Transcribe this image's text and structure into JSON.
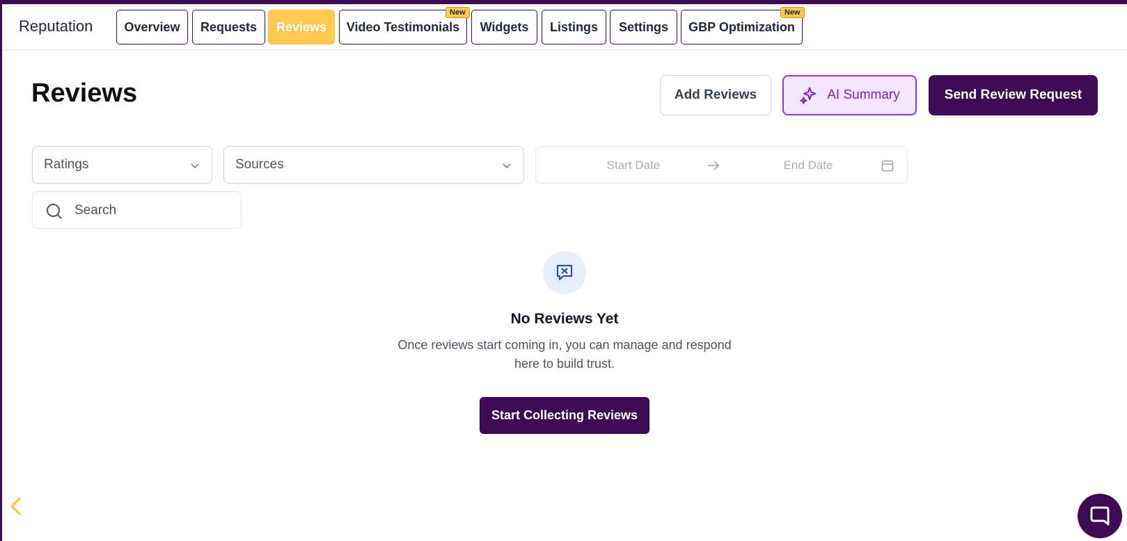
{
  "nav": {
    "brand": "Reputation",
    "tabs": [
      {
        "label": "Overview"
      },
      {
        "label": "Requests"
      },
      {
        "label": "Reviews",
        "active": true
      },
      {
        "label": "Video Testimonials",
        "badge": "New"
      },
      {
        "label": "Widgets"
      },
      {
        "label": "Listings"
      },
      {
        "label": "Settings"
      },
      {
        "label": "GBP Optimization",
        "badge": "New"
      }
    ]
  },
  "header": {
    "title": "Reviews",
    "add_reviews_label": "Add Reviews",
    "ai_summary_label": "AI Summary",
    "send_request_label": "Send Review Request"
  },
  "filters": {
    "ratings_placeholder": "Ratings",
    "sources_placeholder": "Sources",
    "start_date_placeholder": "Start Date",
    "end_date_placeholder": "End Date",
    "search_placeholder": "Search"
  },
  "empty_state": {
    "title": "No Reviews Yet",
    "description_line1": "Once reviews start coming in, you can manage and respond",
    "description_line2": "here to build trust.",
    "cta_label": "Start Collecting Reviews"
  },
  "colors": {
    "brand_primary": "#3d0a55",
    "active_tab": "#fdc94f",
    "ai_accent": "#9333ea"
  },
  "icons": {
    "ai": "sparkles-icon",
    "dropdown": "chevron-down-icon",
    "date_arrow": "arrow-right-icon",
    "calendar": "calendar-icon",
    "search": "search-icon",
    "empty": "message-x-icon",
    "collapse": "chevron-left-icon",
    "chat": "chat-bubble-icon"
  }
}
